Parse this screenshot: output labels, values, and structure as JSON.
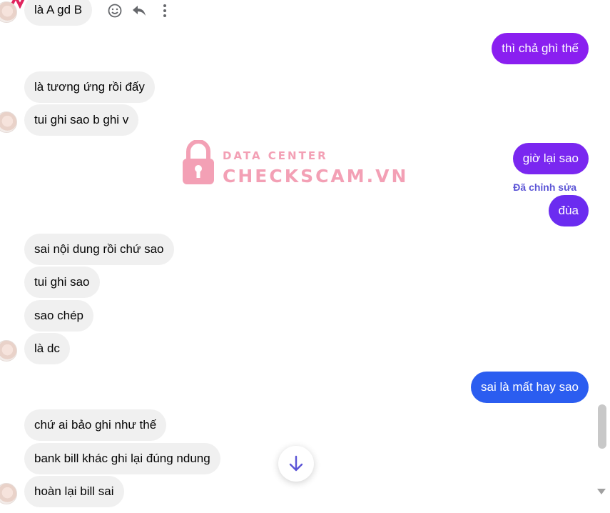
{
  "conversation": {
    "messages": [
      {
        "side": "in",
        "text": "là A gd B"
      },
      {
        "side": "out",
        "text": "thì chả ghì thế"
      },
      {
        "side": "in",
        "text": "là tương ứng rồi đấy"
      },
      {
        "side": "in",
        "text": "tui ghi sao b ghi v"
      },
      {
        "side": "out",
        "text": "giờ lại sao"
      },
      {
        "side": "out",
        "text": "đùa"
      },
      {
        "side": "in",
        "text": "sai nội dung rồi chứ sao"
      },
      {
        "side": "in",
        "text": "tui ghi sao"
      },
      {
        "side": "in",
        "text": "sao chép"
      },
      {
        "side": "in",
        "text": "là dc"
      },
      {
        "side": "out",
        "text": "sai là mất hay sao"
      },
      {
        "side": "in",
        "text": "chứ ai bảo ghi như thế"
      },
      {
        "side": "in",
        "text": "bank bill khác ghi lại đúng ndung"
      },
      {
        "side": "in",
        "text": "hoàn lại bill sai"
      }
    ],
    "edited_label": "Đã chỉnh sửa"
  },
  "message_actions": [
    {
      "icon": "smiley-icon"
    },
    {
      "icon": "reply-icon"
    },
    {
      "icon": "more-options-icon"
    }
  ],
  "watermark": {
    "line1": "DATA CENTER",
    "line2": "CHECKSCAM.VN",
    "color": "#f3a0b5"
  },
  "colors": {
    "incoming_bubble": "#f0f0f0",
    "outgoing_purple": "#8a1ff0",
    "outgoing_violet": "#6b2cf0",
    "outgoing_blue": "#2b5df0",
    "scroll_button_arrow": "#5b54d6"
  }
}
